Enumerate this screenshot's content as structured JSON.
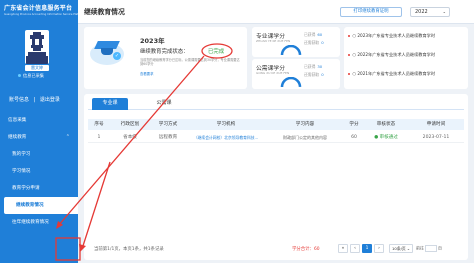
{
  "sidebar": {
    "brand_title": "广东省会计信息服务平台",
    "brand_sub": "Guangdong Province Accounting Information Service Platform",
    "user_name": "雷文婷",
    "user_status": "信息已采集",
    "link_home": "账号信息",
    "link_logout": "退出登录",
    "items": [
      {
        "label": "信息采集"
      },
      {
        "label": "继续教育",
        "arrow": "⌃"
      },
      {
        "label": "我的学习"
      },
      {
        "label": "学习情况"
      },
      {
        "label": "教育学分申请"
      },
      {
        "label": "继续教育情况"
      },
      {
        "label": "往年继续教育情况"
      }
    ]
  },
  "header": {
    "title": "继续教育情况",
    "print_label": "打印继续教育证明",
    "year": "2022"
  },
  "status_card": {
    "year": "2023年",
    "label": "继续教育完成状态：",
    "badge": "已完成",
    "note": "当前您的继续教育学分已达标，公需课需要达到30学分，专业课需要达到60学分",
    "link": "查看要求"
  },
  "credits": {
    "professional": {
      "title": "专业课学分",
      "pinyin": "ZHUAN YE KE XUE FEN",
      "earned_label": "已获得",
      "earned": "60",
      "need_label": "还需获取",
      "need": "0"
    },
    "public": {
      "title": "公需课学分",
      "pinyin": "GONG XU KE XUE FEN",
      "earned_label": "已获得",
      "earned": "30",
      "need_label": "还需获取",
      "need": "0"
    }
  },
  "news": [
    "○ 2023年广东省专业技术人员继续教育学时",
    "○ 2022年广东省专业技术人员继续教育学时",
    "○ 2021年广东省专业技术人员继续教育学时"
  ],
  "tabs": [
    "专业课",
    "公需课"
  ],
  "table": {
    "headers": [
      "序号",
      "行政区划",
      "学习方式",
      "学习机构",
      "学习内容",
      "学分",
      "审核状态",
      "申请时间"
    ],
    "rows": [
      [
        "1",
        "省本级",
        "远程教育",
        "（继续会计网校）北京领导教育科技...",
        "财政部门公定的其他内容",
        "60",
        "● 审核通过",
        "2023-07-11"
      ]
    ]
  },
  "footer": {
    "summary": "当前第1/1页，本页1条，共1条记录",
    "total": "学分合计：60",
    "first": "«",
    "prev": "‹",
    "page": "1",
    "next": "›",
    "last": "»",
    "page_size": "10条/页 ⌄",
    "goto_prefix": "前往",
    "goto_suffix": "页"
  },
  "colors": {
    "primary": "#1f7fd8",
    "success": "#3aa54a",
    "annotation": "#e53935"
  }
}
